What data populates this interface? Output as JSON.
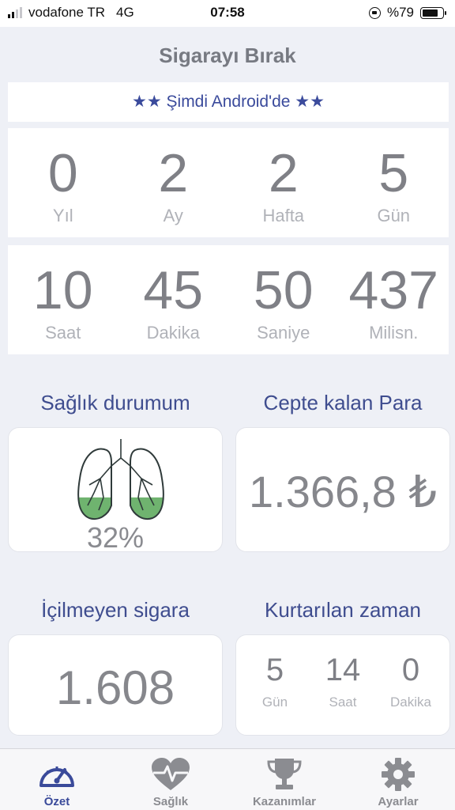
{
  "status_bar": {
    "carrier": "vodafone TR",
    "network": "4G",
    "time": "07:58",
    "battery": "%79",
    "battery_level": 0.79
  },
  "header": {
    "title": "Sigarayı Bırak"
  },
  "promo": {
    "text": "★★ Şimdi Android'de ★★"
  },
  "elapsed_top": [
    {
      "value": "0",
      "label": "Yıl"
    },
    {
      "value": "2",
      "label": "Ay"
    },
    {
      "value": "2",
      "label": "Hafta"
    },
    {
      "value": "5",
      "label": "Gün"
    }
  ],
  "elapsed_bottom": [
    {
      "value": "10",
      "label": "Saat"
    },
    {
      "value": "45",
      "label": "Dakika"
    },
    {
      "value": "50",
      "label": "Saniye"
    },
    {
      "value": "437",
      "label": "Milisn."
    }
  ],
  "health": {
    "title": "Sağlık durumum",
    "percent": "32%",
    "fill_fraction": 0.32
  },
  "money": {
    "title": "Cepte kalan Para",
    "amount": "1.366,8 ₺"
  },
  "cigarettes": {
    "title": "İçilmeyen sigara",
    "count": "1.608"
  },
  "time_saved": {
    "title": "Kurtarılan zaman",
    "items": [
      {
        "value": "5",
        "label": "Gün"
      },
      {
        "value": "14",
        "label": "Saat"
      },
      {
        "value": "0",
        "label": "Dakika"
      }
    ]
  },
  "tabs": [
    {
      "label": "Özet",
      "icon": "speedometer-icon",
      "active": true
    },
    {
      "label": "Sağlık",
      "icon": "heart-pulse-icon",
      "active": false
    },
    {
      "label": "Kazanımlar",
      "icon": "trophy-icon",
      "active": false
    },
    {
      "label": "Ayarlar",
      "icon": "gear-icon",
      "active": false
    }
  ],
  "colors": {
    "accent": "#3a4a9a",
    "lung_fill": "#6fb36f",
    "background": "#eef0f6"
  }
}
